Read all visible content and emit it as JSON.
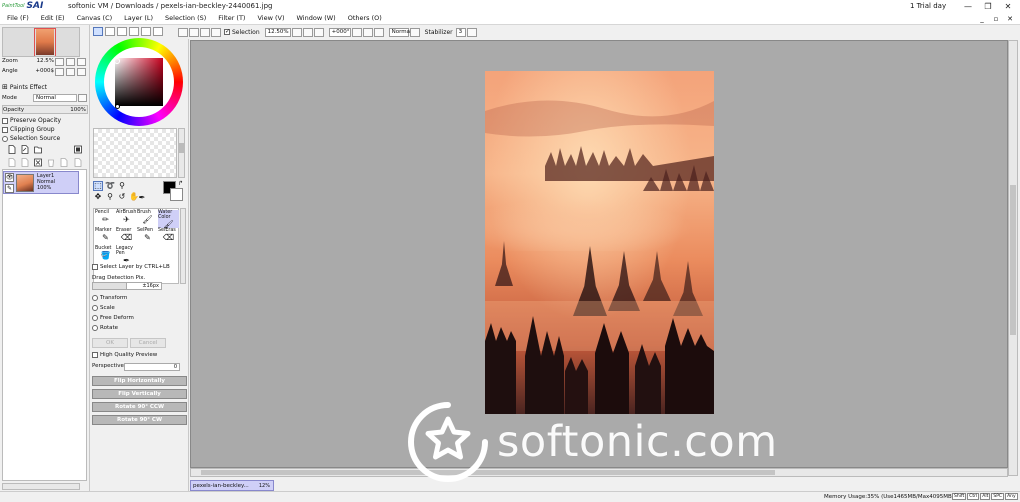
{
  "titlebar": {
    "logo_small": "PaintTool",
    "logo_big": "SAI",
    "title": "softonic VM / Downloads / pexels-ian-beckley-2440061.jpg",
    "trial": "1 Trial day",
    "minimize": "—",
    "restore": "❐",
    "close": "✕"
  },
  "menu": {
    "items": [
      "File (F)",
      "Edit (E)",
      "Canvas (C)",
      "Layer (L)",
      "Selection (S)",
      "Filter (T)",
      "View (V)",
      "Window (W)",
      "Others (O)"
    ],
    "min": "_",
    "restore": "▫",
    "close": "✕"
  },
  "navigator": {
    "zoom_label": "Zoom",
    "zoom_value": "12.5%",
    "angle_label": "Angle",
    "angle_value": "+000$"
  },
  "layer_props": {
    "paints_effect": "Paints Effect",
    "mode_label": "Mode",
    "mode_value": "Normal",
    "opacity_label": "Opacity",
    "opacity_value": "100%",
    "opacity_level": 1.0,
    "preserve_opacity": "Preserve Opacity",
    "clipping_group": "Clipping Group",
    "selection_source": "Selection Source"
  },
  "layers": [
    {
      "name": "Layer1",
      "mode": "Normal",
      "opacity": "100%"
    }
  ],
  "brushes": [
    {
      "label": "Pencil"
    },
    {
      "label": "AirBrush"
    },
    {
      "label": "Brush"
    },
    {
      "label": "Water Color"
    },
    {
      "label": "Marker"
    },
    {
      "label": "Eraser"
    },
    {
      "label": "SelPen"
    },
    {
      "label": "SelEras"
    },
    {
      "label": "Bucket"
    },
    {
      "label": "Legacy Pen"
    }
  ],
  "tool_options": {
    "select_layer": "Select Layer by CTRL+LB",
    "drag_label": "Drag Detection Pix.",
    "drag_value": "±16px",
    "transform": "Transform",
    "scale": "Scale",
    "free_deform": "Free Deform",
    "rotate": "Rotate",
    "ok": "OK",
    "cancel": "Cancel",
    "high_quality": "High Quality Preview",
    "perspective_label": "Perspective",
    "perspective_value": "0",
    "flip_h": "Flip Horizontally",
    "flip_v": "Flip Vertically",
    "rot_ccw": "Rotate 90° CCW",
    "rot_cw": "Rotate 90° CW"
  },
  "toolbar": {
    "selection": "Selection",
    "zoom": "12.50%",
    "angle": "+000°",
    "mode": "Normal",
    "stabilizer_label": "Stabilizer",
    "stabilizer_value": "3"
  },
  "doc_tab": {
    "name": "pexels-ian-beckley...",
    "zoom": "12%"
  },
  "status": {
    "memory": "Memory Usage:35% (Use1465MB/Max4095MB)",
    "keys": [
      "Shift",
      "Ctrl",
      "Alt",
      "SPC",
      "Any"
    ]
  },
  "watermark": {
    "text": "softonic.com"
  },
  "colors": {
    "accent": "#cfcff7",
    "canvas_bg": "#aaaaaa",
    "primary_color": "#000000",
    "secondary_color": "#ffffff",
    "picked_hue": "#c8001e"
  }
}
